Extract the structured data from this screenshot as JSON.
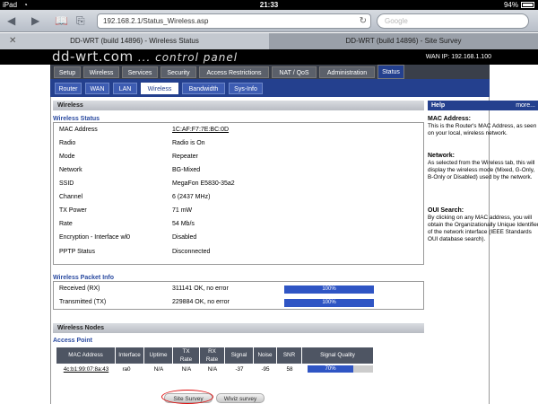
{
  "status_bar": {
    "device": "iPad",
    "time": "21:33",
    "battery": "94%"
  },
  "browser": {
    "url": "192.168.2.1/Status_Wireless.asp",
    "search_placeholder": "Google",
    "tabs": [
      {
        "title": "DD-WRT (build 14896) - Wireless Status"
      },
      {
        "title": "DD-WRT (build 14896) - Site Survey"
      }
    ]
  },
  "router": {
    "logo": "dd-wrt.com",
    "logo_sub": "... control panel",
    "wan_ip": "WAN IP: 192.168.1.100",
    "main_nav": [
      "Setup",
      "Wireless",
      "Services",
      "Security",
      "Access Restrictions",
      "NAT / QoS",
      "Administration",
      "Status"
    ],
    "sub_nav": [
      "Router",
      "WAN",
      "LAN",
      "Wireless",
      "Bandwidth",
      "Sys-Info"
    ]
  },
  "wireless": {
    "section_title": "Wireless",
    "status_legend": "Wireless Status",
    "rows": [
      {
        "label": "MAC Address",
        "value": "1C:AF:F7:7E:BC:0D"
      },
      {
        "label": "Radio",
        "value": "Radio is On"
      },
      {
        "label": "Mode",
        "value": "Repeater"
      },
      {
        "label": "Network",
        "value": "BG-Mixed"
      },
      {
        "label": "SSID",
        "value": "MegaFon E5830-35a2"
      },
      {
        "label": "Channel",
        "value": "6 (2437 MHz)"
      },
      {
        "label": "TX Power",
        "value": "71 mW"
      },
      {
        "label": "Rate",
        "value": "54 Mb/s"
      },
      {
        "label": "Encryption - Interface wl0",
        "value": "Disabled"
      },
      {
        "label": "PPTP Status",
        "value": "Disconnected"
      }
    ],
    "packet_legend": "Wireless Packet Info",
    "packets": [
      {
        "label": "Received (RX)",
        "value": "311141 OK, no error",
        "bar": "100%"
      },
      {
        "label": "Transmitted (TX)",
        "value": "229884 OK, no error",
        "bar": "100%"
      }
    ]
  },
  "nodes": {
    "section_title": "Wireless Nodes",
    "legend": "Access Point",
    "headers": [
      "MAC Address",
      "Interface",
      "Uptime",
      "TX\nRate",
      "RX\nRate",
      "Signal",
      "Noise",
      "SNR",
      "Signal Quality"
    ],
    "row": {
      "mac": "4c:b1:99:07:8a:43",
      "interface": "ra0",
      "uptime": "N/A",
      "tx": "N/A",
      "rx": "N/A",
      "signal": "-37",
      "noise": "-95",
      "snr": "58",
      "quality": "70%"
    },
    "buttons": {
      "site_survey": "Site Survey",
      "wivi": "Wiviz survey"
    }
  },
  "help": {
    "title": "Help",
    "more": "more...",
    "sections": [
      {
        "head": "MAC Address:",
        "text": "This is the Router's MAC Address, as seen on your local, wireless network."
      },
      {
        "head": "Network:",
        "text": "As selected from the Wireless tab, this will display the wireless mode (Mixed, G-Only, B-Only or Disabled) used by the network."
      },
      {
        "head": "OUI Search:",
        "text": "By clicking on any MAC address, you will obtain the Organizationally Unique Identifier of the network interface (IEEE Standards OUI database search)."
      }
    ]
  }
}
